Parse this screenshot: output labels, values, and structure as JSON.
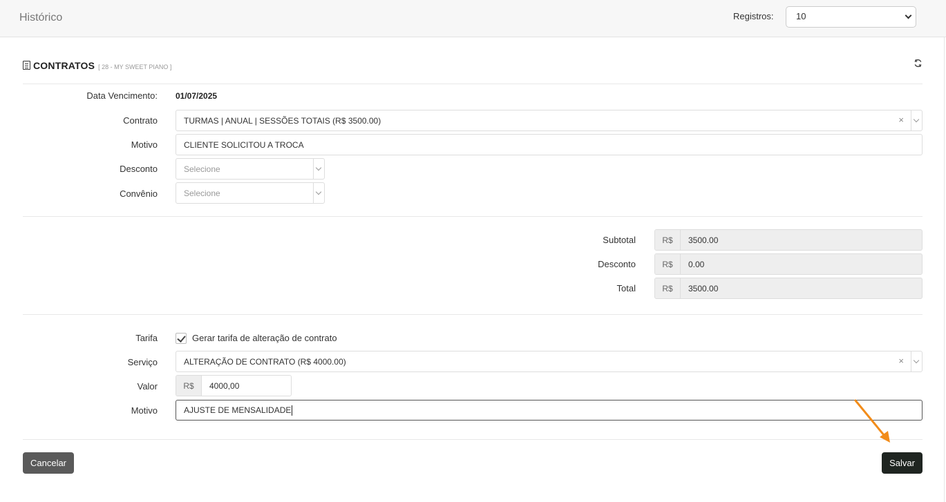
{
  "topbar": {
    "title": "Histórico",
    "registros_label": "Registros:",
    "registros_value": "10"
  },
  "header": {
    "title": "CONTRATOS",
    "subtitle": "[ 28 - MY SWEET PIANO ]"
  },
  "form": {
    "data_vencimento_label": "Data Vencimento:",
    "data_vencimento_value": "01/07/2025",
    "contrato_label": "Contrato",
    "contrato_value": "TURMAS | ANUAL | SESSÕES TOTAIS (R$ 3500.00)",
    "motivo_label": "Motivo",
    "motivo_value": "CLIENTE SOLICITOU A TROCA",
    "desconto_label": "Desconto",
    "desconto_placeholder": "Selecione",
    "convenio_label": "Convênio",
    "convenio_placeholder": "Selecione"
  },
  "totals": {
    "currency": "R$",
    "subtotal_label": "Subtotal",
    "subtotal_value": "3500.00",
    "desconto_label": "Desconto",
    "desconto_value": "0.00",
    "total_label": "Total",
    "total_value": "3500.00"
  },
  "tarifa": {
    "tarifa_label": "Tarifa",
    "checkbox_label": "Gerar tarifa de alteração de contrato",
    "checked": true,
    "servico_label": "Serviço",
    "servico_value": "ALTERAÇÃO DE CONTRATO (R$ 4000.00)",
    "valor_label": "Valor",
    "valor_currency": "R$",
    "valor_value": "4000,00",
    "motivo_label": "Motivo",
    "motivo_value": "AJUSTE DE MENSALIDADE"
  },
  "actions": {
    "cancel_label": "Cancelar",
    "save_label": "Salvar"
  },
  "colors": {
    "annotation_arrow": "#f28c1a",
    "save_button": "#1f2521",
    "cancel_button": "#5a5a5a"
  },
  "clear_glyph": "×"
}
